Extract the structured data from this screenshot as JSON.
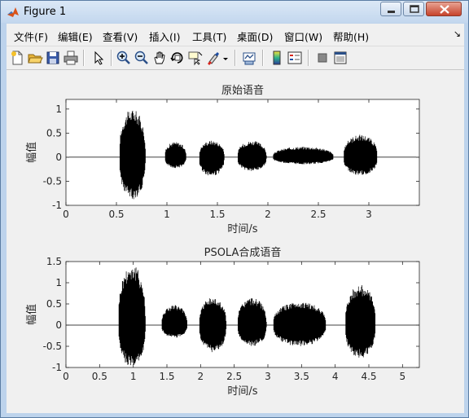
{
  "window": {
    "title": "Figure 1"
  },
  "menu": [
    {
      "label": "文件(F)",
      "name": "menu-file"
    },
    {
      "label": "编辑(E)",
      "name": "menu-edit"
    },
    {
      "label": "查看(V)",
      "name": "menu-view"
    },
    {
      "label": "插入(I)",
      "name": "menu-insert"
    },
    {
      "label": "工具(T)",
      "name": "menu-tools"
    },
    {
      "label": "桌面(D)",
      "name": "menu-desktop"
    },
    {
      "label": "窗口(W)",
      "name": "menu-window"
    },
    {
      "label": "帮助(H)",
      "name": "menu-help"
    }
  ],
  "toolbar": [
    {
      "name": "new-figure-icon"
    },
    {
      "name": "open-file-icon"
    },
    {
      "name": "save-icon"
    },
    {
      "name": "print-icon"
    },
    {
      "name": "select-arrow-icon"
    },
    {
      "name": "zoom-in-icon"
    },
    {
      "name": "zoom-out-icon"
    },
    {
      "name": "pan-hand-icon"
    },
    {
      "name": "rotate-3d-icon"
    },
    {
      "name": "data-cursor-icon"
    },
    {
      "name": "brush-icon"
    },
    {
      "name": "link-plot-icon"
    },
    {
      "name": "colorbar-icon"
    },
    {
      "name": "legend-icon"
    },
    {
      "name": "hide-plot-tools-icon"
    },
    {
      "name": "show-plot-tools-icon"
    }
  ],
  "chart_data": [
    {
      "type": "line",
      "title": "原始语音",
      "xlabel": "时间/s",
      "ylabel": "幅值",
      "xlim": [
        0,
        3.5
      ],
      "ylim": [
        -1,
        1.2
      ],
      "xticks": [
        "0",
        "0.5",
        "1",
        "1.5",
        "2",
        "2.5",
        "3"
      ],
      "yticks": [
        "-1",
        "-0.5",
        "0",
        "0.5",
        "1"
      ],
      "segments": [
        {
          "start": 0.53,
          "end": 0.8,
          "amp": 1.0,
          "min": -0.88
        },
        {
          "start": 0.98,
          "end": 1.2,
          "amp": 0.32,
          "min": -0.23
        },
        {
          "start": 1.32,
          "end": 1.58,
          "amp": 0.35,
          "min": -0.4
        },
        {
          "start": 1.7,
          "end": 2.0,
          "amp": 0.34,
          "min": -0.3
        },
        {
          "start": 2.05,
          "end": 2.68,
          "amp": 0.22,
          "min": -0.15
        },
        {
          "start": 2.75,
          "end": 3.1,
          "amp": 0.47,
          "min": -0.38
        }
      ],
      "color": "#000000"
    },
    {
      "type": "line",
      "title": "PSOLA合成语音",
      "xlabel": "时间/s",
      "ylabel": "幅值",
      "xlim": [
        0,
        5.25
      ],
      "ylim": [
        -1,
        1.5
      ],
      "xticks": [
        "0",
        "0.5",
        "1",
        "1.5",
        "2",
        "2.5",
        "3",
        "3.5",
        "4",
        "4.5",
        "5"
      ],
      "yticks": [
        "-1",
        "-0.5",
        "0",
        "0.5",
        "1",
        "1.5"
      ],
      "segments": [
        {
          "start": 0.78,
          "end": 1.2,
          "amp": 1.45,
          "min": -1.0
        },
        {
          "start": 1.42,
          "end": 1.82,
          "amp": 0.48,
          "min": -0.3
        },
        {
          "start": 1.98,
          "end": 2.4,
          "amp": 0.65,
          "min": -0.65
        },
        {
          "start": 2.55,
          "end": 3.0,
          "amp": 0.65,
          "min": -0.5
        },
        {
          "start": 3.08,
          "end": 3.9,
          "amp": 0.55,
          "min": -0.5
        },
        {
          "start": 4.15,
          "end": 4.62,
          "amp": 0.95,
          "min": -0.78
        }
      ],
      "color": "#000000"
    }
  ]
}
